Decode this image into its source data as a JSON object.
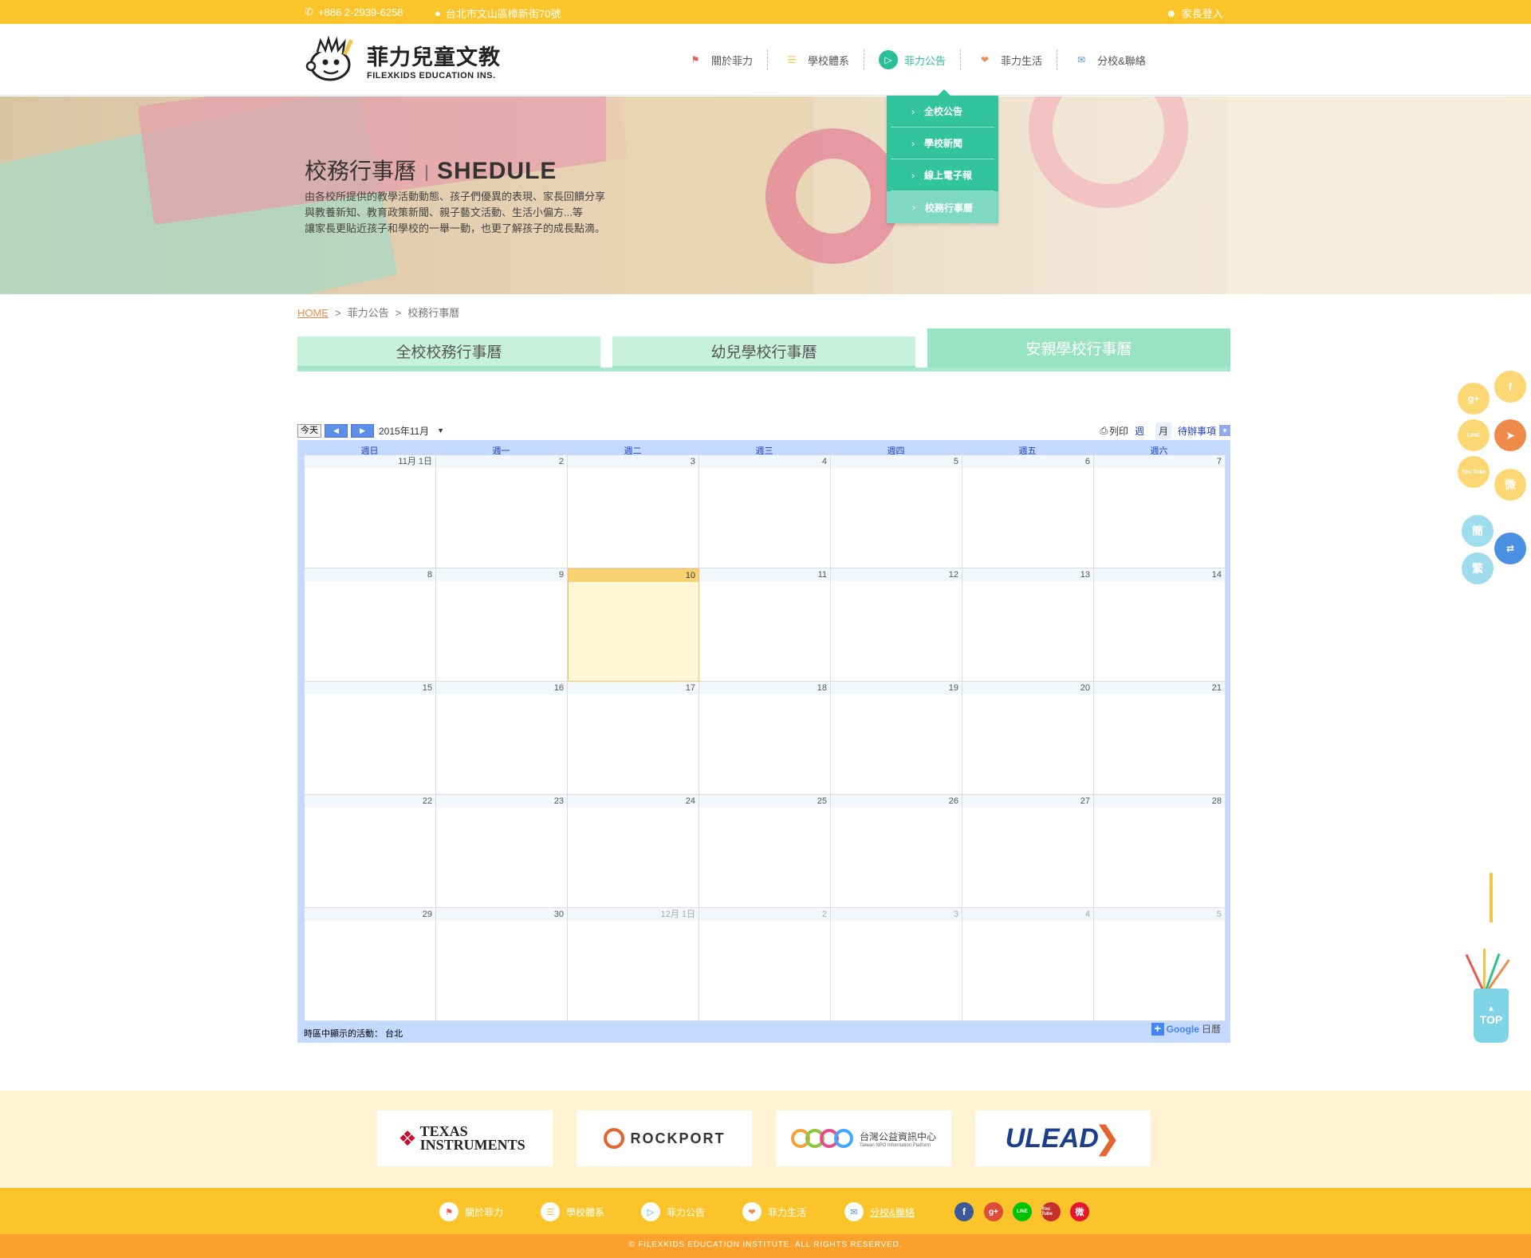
{
  "topbar": {
    "phone": "+886 2-2939-6258",
    "address": "台北市文山區樟新街70號",
    "login": "家長登入"
  },
  "logo": {
    "name": "菲力兒童文教",
    "sub": "FILEXKIDS EDUCATION INS."
  },
  "nav": {
    "items": [
      {
        "label": "關於菲力",
        "icon": "flag-icon",
        "color": "#e85a4f"
      },
      {
        "label": "學校體系",
        "icon": "book-stack-icon",
        "color": "#f2c34a"
      },
      {
        "label": "菲力公告",
        "icon": "megaphone-icon",
        "color": "#2bbf98"
      },
      {
        "label": "菲力生活",
        "icon": "hearts-icon",
        "color": "#f08a4b"
      },
      {
        "label": "分校&聯絡",
        "icon": "mail-icon",
        "color": "#4a90e2"
      }
    ]
  },
  "dropdown": {
    "items": [
      "全校公告",
      "學校新聞",
      "線上電子報",
      "校務行事曆"
    ]
  },
  "hero": {
    "title": "校務行事曆",
    "title_en": "SHEDULE",
    "desc1": "由各校所提供的教學活動動態、孩子們優異的表現、家長回饋分享",
    "desc2": "與教養新知、教育政策新聞、親子藝文活動、生活小偏方...等",
    "desc3": "讓家長更貼近孩子和學校的一舉一動，也更了解孩子的成長點滴。"
  },
  "breadcrumb": {
    "home": "HOME",
    "sep": ">",
    "level1": "菲力公告",
    "level2": "校務行事曆"
  },
  "tabs": [
    "全校校務行事曆",
    "幼兒學校行事曆",
    "安親學校行事曆"
  ],
  "calendar": {
    "today_btn": "今天",
    "month_label": "2015年11月",
    "print": "列印",
    "view_week": "週",
    "view_month": "月",
    "view_agenda": "待辦事項",
    "days": [
      "週日",
      "週一",
      "週二",
      "週三",
      "週四",
      "週五",
      "週六"
    ],
    "weeks": [
      [
        "11月 1日",
        "2",
        "3",
        "4",
        "5",
        "6",
        "7"
      ],
      [
        "8",
        "9",
        "10",
        "11",
        "12",
        "13",
        "14"
      ],
      [
        "15",
        "16",
        "17",
        "18",
        "19",
        "20",
        "21"
      ],
      [
        "22",
        "23",
        "24",
        "25",
        "26",
        "27",
        "28"
      ],
      [
        "29",
        "30",
        "12月 1日",
        "2",
        "3",
        "4",
        "5"
      ]
    ],
    "timezone": "時區中顯示的活動： 台北",
    "google": "Google",
    "google_suffix": "日曆",
    "plus": "+"
  },
  "sponsors": [
    {
      "name": "TEXAS INSTRUMENTS",
      "icon": "ti-logo"
    },
    {
      "name": "ROCKPORT",
      "icon": "rockport-logo"
    },
    {
      "name": "台灣公益資訊中心",
      "sub": "Taiwan NPO Information Platform",
      "icon": "npo-logo"
    },
    {
      "name": "ULEAD",
      "icon": "ulead-logo"
    }
  ],
  "footer": {
    "copyright": "© FILEXKIDS EDUCATION INSTITUTE. ALL RIGHTS RESERVED."
  },
  "social": {
    "facebook": "f",
    "google": "g+",
    "line": "LINE",
    "youtube": "You Tube",
    "weibo": "微",
    "simplified": "簡",
    "traditional": "繁",
    "top": "TOP"
  }
}
